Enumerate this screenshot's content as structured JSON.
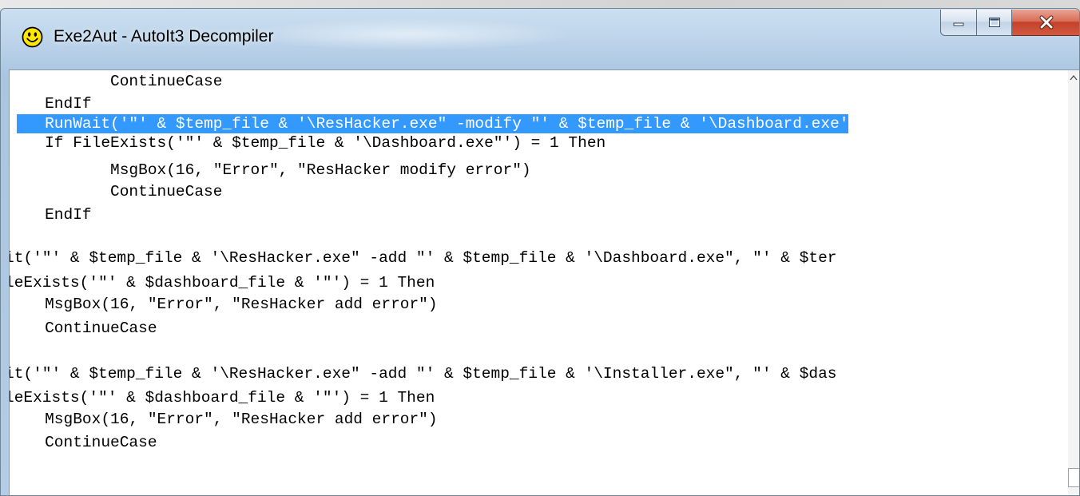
{
  "window": {
    "title": "Exe2Aut - AutoIt3 Decompiler",
    "icon": "smiley-icon",
    "controls": [
      "minimize-icon",
      "maximize-icon",
      "close-icon"
    ]
  },
  "editor": {
    "lines": [
      "          ContinueCase",
      "   EndIf",
      "   RunWait('\"' & $temp_file & '\\ResHacker.exe\" -modify \"' & $temp_file & '\\Dashboard.exe'",
      "   If FileExists('\"' & $temp_file & '\\Dashboard.exe\"') = 1 Then",
      "          MsgBox(16, \"Error\", \"ResHacker modify error\")",
      "          ContinueCase",
      "   EndIf",
      "",
      "it('\"' & $temp_file & '\\ResHacker.exe\" -add \"' & $temp_file & '\\Dashboard.exe\", \"' & $ter",
      "leExists('\"' & $dashboard_file & '\"') = 1 Then",
      "   MsgBox(16, \"Error\", \"ResHacker add error\")",
      "   ContinueCase",
      "",
      "it('\"' & $temp_file & '\\ResHacker.exe\" -add \"' & $temp_file & '\\Installer.exe\", \"' & $das",
      "leExists('\"' & $dashboard_file & '\"') = 1 Then",
      "   MsgBox(16, \"Error\", \"ResHacker add error\")",
      "   ContinueCase"
    ],
    "selected_line": 2,
    "selection_color": "#3399ff"
  },
  "colors": {
    "frame": "#b4cde6",
    "close_button": "#c4412a",
    "editor_background": "#ffffff"
  }
}
